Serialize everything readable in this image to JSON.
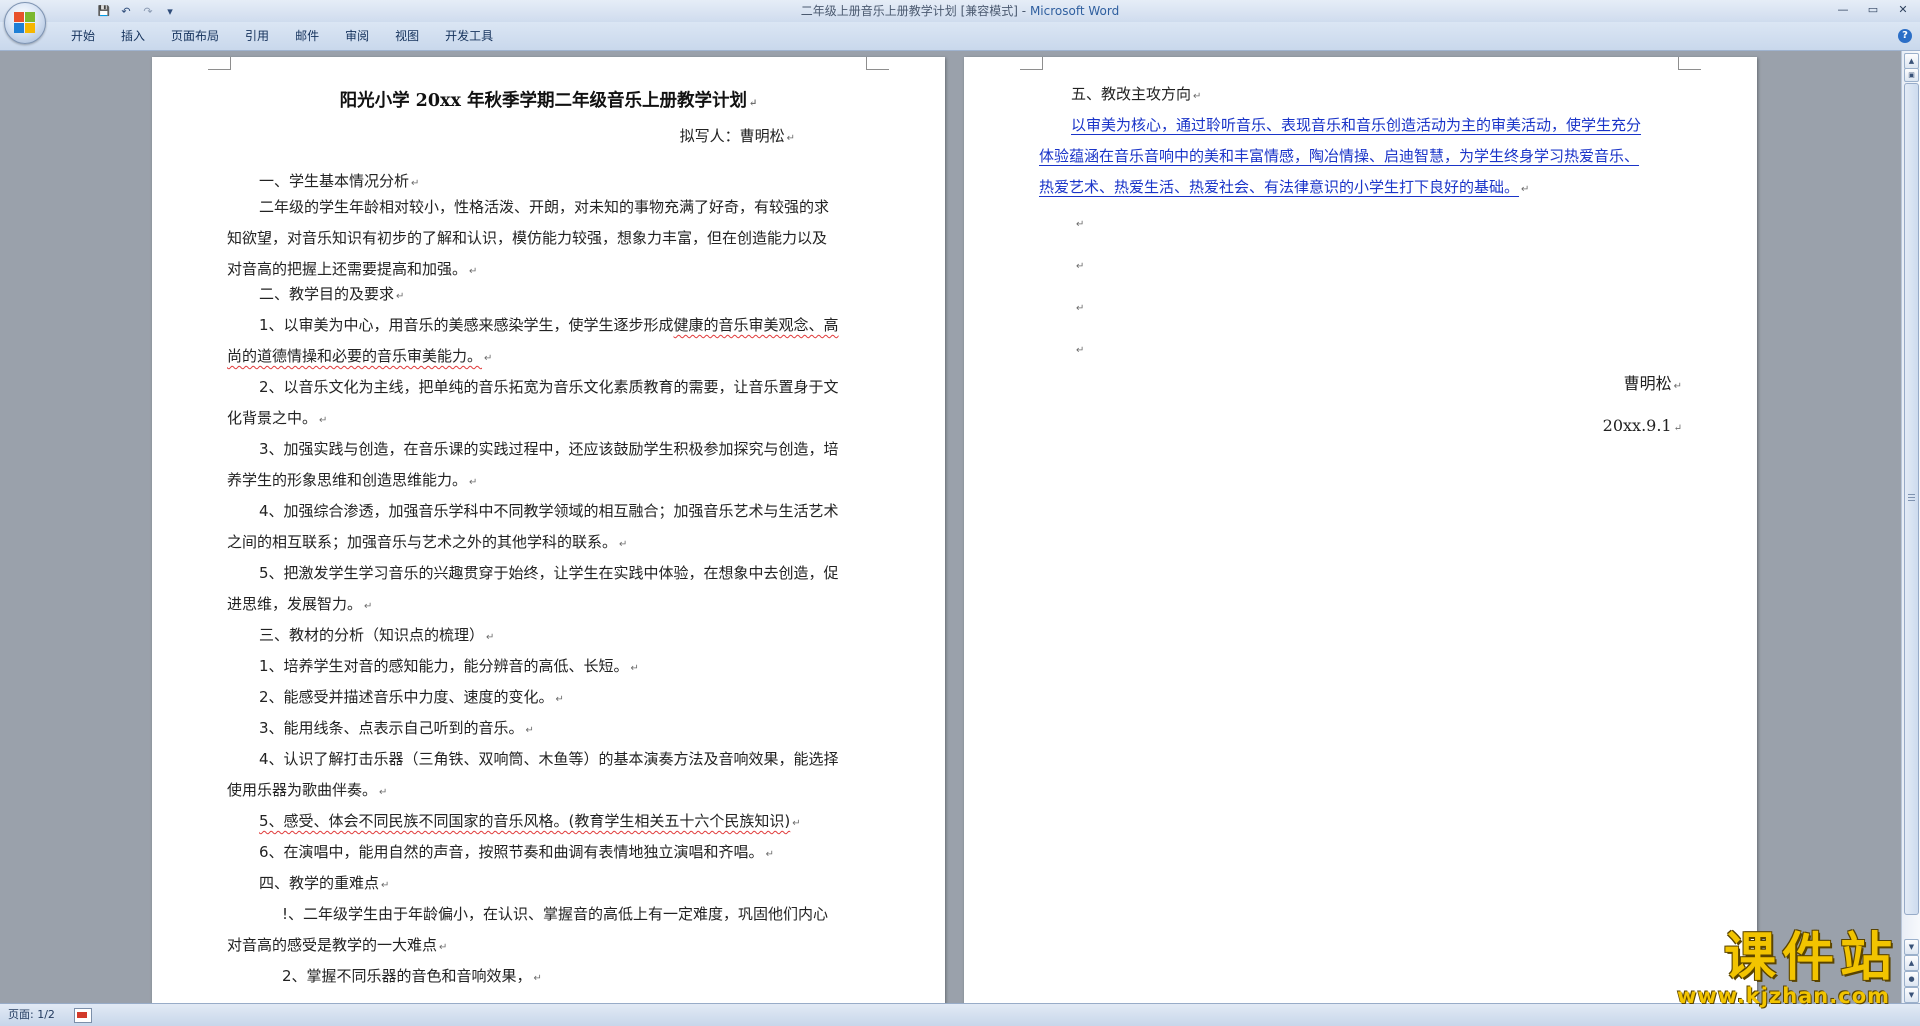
{
  "window": {
    "doc_title": "二年级上册音乐上册教学计划 [兼容模式]",
    "separator": " - ",
    "app_name": "Microsoft Word",
    "controls": {
      "minimize": "—",
      "restore": "▭",
      "close": "✕"
    }
  },
  "qat": {
    "save": "💾",
    "undo": "↶",
    "redo": "↷",
    "customize": "▾"
  },
  "ribbon": {
    "tabs": [
      "开始",
      "插入",
      "页面布局",
      "引用",
      "邮件",
      "审阅",
      "视图",
      "开发工具"
    ],
    "help": "?"
  },
  "colors": {
    "accent": "#2f5f9f",
    "link_blue": "#1a34c8",
    "spell_red": "#e03a3a",
    "watermark": "#f2c400"
  },
  "page1": {
    "heading": "阳光小学 20xx 年秋季学期二年级音乐上册教学计划",
    "author": "拟写人：曹明松",
    "paragraphs": [
      "一、学生基本情况分析",
      "二年级的学生年龄相对较小，性格活泼、开朗，对未知的事物充满了好奇，有较强的求",
      "知欲望，对音乐知识有初步的了解和认识，模仿能力较强，想象力丰富，但在创造能力以及",
      "对音高的把握上还需要提高和加强。",
      "二、教学目的及要求",
      "1、以审美为中心，用音乐的美感来感染学生，使学生逐步形成",
      "健康的音乐审美观念、高",
      "尚的道德情操和必要的音乐审美能力。",
      "2、以音乐文化为主线，把单纯的音乐拓宽为音乐文化素质教育的需要，让音乐置身于文",
      "化背景之中。",
      "3、加强实践与创造，在音乐课的实践过程中，还应该鼓励学生积极参加探究与创造，培",
      "养学生的形象思维和创造思维能力。",
      "4、加强综合渗透，加强音乐学科中不同教学领域的相互融合；加强音乐艺术与生活艺术",
      "之间的相互联系；加强音乐与艺术之外的其他学科的联系。",
      "5、把激发学生学习音乐的兴趣贯穿于始终，让学生在实践中体验，在想象中去创造，促",
      "进思维，发展智力。",
      "三、教材的分析（知识点的梳理）",
      "1、培养学生对音的感知能力，能分辨音的高低、长短。",
      "2、能感受并描述音乐中力度、速度的变化。",
      "3、能用线条、点表示自己听到的音乐。",
      "4、认识了解打击乐器（三角铁、双响筒、木鱼等）的基本演奏方法及音响效果，能选择",
      "使用乐器为歌曲伴奏。",
      "5、感受、体会不同民族不同国家的音乐风格。(教育学生相关五十六个民族知识)",
      "6、在演唱中，能用自然的声音，按照节奏和曲调有表情地独立演唱和齐唱。",
      "四、教学的重难点",
      "!、二年级学生由于年龄偏小，在认识、掌握音的高低上有一定难度，巩固他们内心",
      "对音高的感受是教学的一大难点",
      "2、掌握不同乐器的音色和音响效果，"
    ]
  },
  "page2": {
    "section_title": "五、教改主攻方向",
    "blue_lines": [
      "以审美为核心，通过聆听音乐、表现音乐和音乐创造活动为主的审美活动，使学生充分",
      "体验蕴涵在音乐音响中的美和丰富情感，陶冶情操、启迪智慧，为学生终身学习热爱音乐、",
      "热爱艺术、热爱生活、热爱社会、有法律意识的小学生打下良好的基础。"
    ],
    "signature": "曹明松",
    "date": "20xx.9.1"
  },
  "paragraph_mark": "↵",
  "status": {
    "page": "页面: 1/2"
  },
  "watermark": {
    "main": "课件站",
    "url": "www.kjzhan.com"
  }
}
